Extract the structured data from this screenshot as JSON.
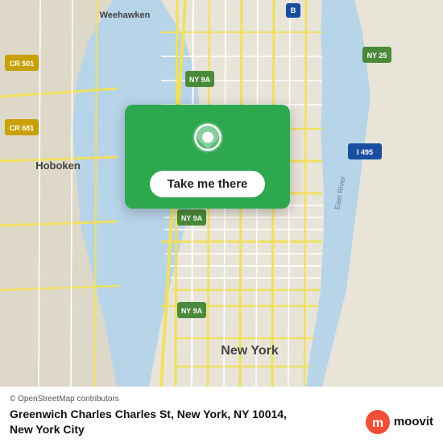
{
  "map": {
    "alt": "Map of New York City area showing Manhattan, Hoboken, and surrounding areas"
  },
  "card": {
    "button_label": "Take me there"
  },
  "bottom_bar": {
    "osm_credit": "© OpenStreetMap contributors",
    "location_line1": "Greenwich Charles Charles St, New York, NY 10014,",
    "location_line2": "New York City",
    "moovit_label": "moovit"
  },
  "colors": {
    "card_bg": "#2ea84f",
    "button_bg": "#ffffff",
    "road_yellow": "#f9e04b",
    "road_white": "#ffffff",
    "water_blue": "#a8c8e8",
    "land": "#e8e4d8",
    "label_text": "#555"
  }
}
